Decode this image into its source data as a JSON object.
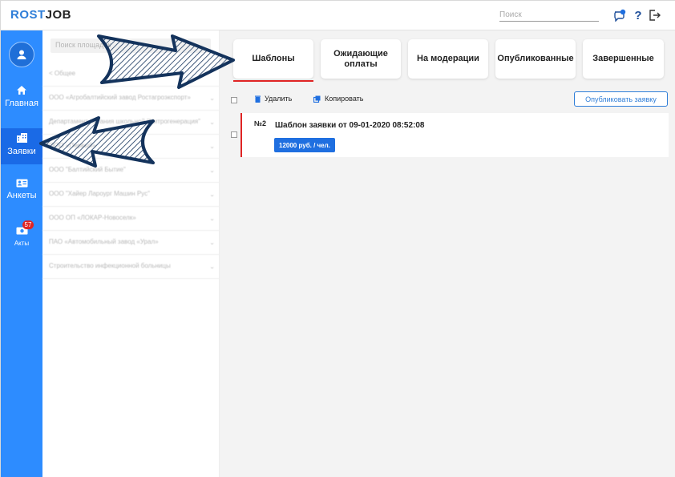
{
  "header": {
    "logo_part1": "ROST",
    "logo_part2": "JOB",
    "search_placeholder": "Поиск",
    "help_label": "?",
    "notification_count": "1"
  },
  "sidebar": {
    "items": [
      {
        "label": "Главная",
        "icon": "home-icon"
      },
      {
        "label": "Заявки",
        "icon": "building-icon",
        "active": true
      },
      {
        "label": "Анкеты",
        "icon": "id-card-icon"
      },
      {
        "label": "Акты",
        "icon": "money-icon",
        "badge": "57"
      }
    ]
  },
  "panel": {
    "search_placeholder": "Поиск площадок",
    "organizations": [
      "< Общее",
      "ООО «Агробалтийский завод Ростагроэкспорт»",
      "Департамент питания школьной \"Нитрогенерация\"",
      "ООО «Первый»",
      "ООО \"Балтийский Бытие\"",
      "ООО \"Хайер Лароург Машин Рус\"",
      "ООО ОП «ЛОКАР-Новоселк»",
      "ПАО «Автомобильный завод «Урал»",
      "Строительство инфекционной больницы"
    ]
  },
  "tabs": [
    {
      "label": "Шаблоны",
      "active": true
    },
    {
      "label": "Ожидающие оплаты"
    },
    {
      "label": "На модерации"
    },
    {
      "label": "Опубликованные"
    },
    {
      "label": "Завершенные"
    }
  ],
  "toolbar": {
    "delete_label": "Удалить",
    "copy_label": "Копировать",
    "publish_label": "Опубликовать заявку"
  },
  "requests": [
    {
      "number": "№2",
      "title": "Шаблон заявки от 09-01-2020 08:52:08",
      "price": "12000 руб. / чел."
    }
  ],
  "colors": {
    "sidebar": "#2d8cff",
    "sidebar_active": "#1a6ae6",
    "accent": "#2f7ed8",
    "danger": "#e02424",
    "arrow": "#14335c"
  }
}
